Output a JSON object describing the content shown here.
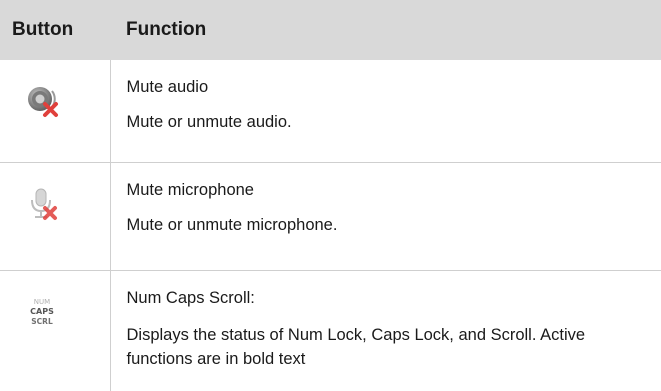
{
  "header": {
    "button_label": "Button",
    "function_label": "Function"
  },
  "rows": [
    {
      "icon": "mute-audio-icon",
      "title": "Mute audio",
      "description": "Mute or unmute audio."
    },
    {
      "icon": "mute-microphone-icon",
      "title": "Mute microphone",
      "description": "Mute or unmute microphone."
    },
    {
      "icon": "num-caps-scroll-icon",
      "icon_text": [
        "NUM",
        "CAPS",
        "SCRL"
      ],
      "title": "Num Caps Scroll:",
      "description": "Displays the status of Num Lock, Caps Lock, and Scroll. Active functions are in bold text"
    }
  ],
  "colors": {
    "header_bg": "#d9d9d9",
    "divider": "#cfcfcf",
    "red_x": "#e0403c"
  }
}
